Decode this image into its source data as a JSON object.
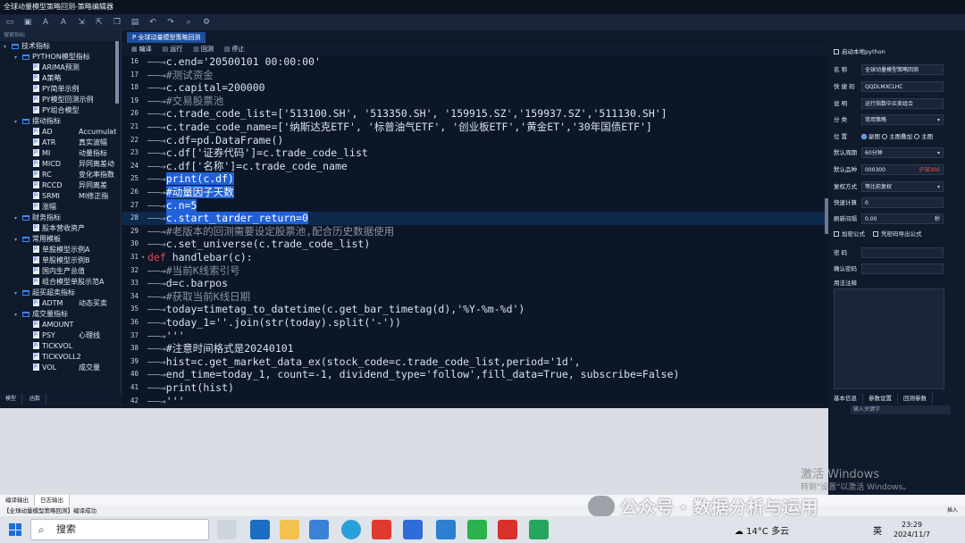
{
  "window": {
    "title": "全球动量模型策略回测-策略编辑器"
  },
  "left_panel": {
    "search_placeholder": "搜索指标",
    "tree": [
      {
        "level": 0,
        "type": "folder",
        "label": "技术指标",
        "expanded": true
      },
      {
        "level": 1,
        "type": "folder",
        "label": "PYTHON模型指标",
        "expanded": true
      },
      {
        "level": 2,
        "type": "file",
        "label": "ARIMA预测",
        "desc": ""
      },
      {
        "level": 2,
        "type": "file",
        "label": "A策略",
        "desc": ""
      },
      {
        "level": 2,
        "type": "file",
        "label": "PY简单示例",
        "desc": ""
      },
      {
        "level": 2,
        "type": "file",
        "label": "PY模型回测示例",
        "desc": ""
      },
      {
        "level": 2,
        "type": "file",
        "label": "PY组合模型",
        "desc": ""
      },
      {
        "level": 1,
        "type": "folder",
        "label": "摆动指标",
        "expanded": true
      },
      {
        "level": 2,
        "type": "file",
        "label": "AD",
        "desc": "Accumulat"
      },
      {
        "level": 2,
        "type": "file",
        "label": "ATR",
        "desc": "真实波幅"
      },
      {
        "level": 2,
        "type": "file",
        "label": "MI",
        "desc": "动量指标"
      },
      {
        "level": 2,
        "type": "file",
        "label": "MICD",
        "desc": "异同离差动"
      },
      {
        "level": 2,
        "type": "file",
        "label": "RC",
        "desc": "变化率指数"
      },
      {
        "level": 2,
        "type": "file",
        "label": "RCCD",
        "desc": "异同离差"
      },
      {
        "level": 2,
        "type": "file",
        "label": "SRMI",
        "desc": "MI修正指"
      },
      {
        "level": 2,
        "type": "file",
        "label": "涨幅",
        "desc": ""
      },
      {
        "level": 1,
        "type": "folder",
        "label": "财务指标",
        "expanded": true
      },
      {
        "level": 2,
        "type": "file",
        "label": "股本营收资产",
        "desc": ""
      },
      {
        "level": 1,
        "type": "folder",
        "label": "常用模板",
        "expanded": true
      },
      {
        "level": 2,
        "type": "file",
        "label": "单股模型示例A",
        "desc": ""
      },
      {
        "level": 2,
        "type": "file",
        "label": "单股模型示例B",
        "desc": ""
      },
      {
        "level": 2,
        "type": "file",
        "label": "国内生产总值",
        "desc": ""
      },
      {
        "level": 2,
        "type": "file",
        "label": "组合模型单股示范A",
        "desc": ""
      },
      {
        "level": 1,
        "type": "folder",
        "label": "超买超卖指标",
        "expanded": true
      },
      {
        "level": 2,
        "type": "file",
        "label": "ADTM",
        "desc": "动态买卖"
      },
      {
        "level": 1,
        "type": "folder",
        "label": "成交量指标",
        "expanded": true
      },
      {
        "level": 2,
        "type": "file",
        "label": "AMOUNT",
        "desc": ""
      },
      {
        "level": 2,
        "type": "file",
        "label": "PSY",
        "desc": "心理线"
      },
      {
        "level": 2,
        "type": "file",
        "label": "TICKVOL",
        "desc": ""
      },
      {
        "level": 2,
        "type": "file",
        "label": "TICKVOLL2",
        "desc": ""
      },
      {
        "level": 2,
        "type": "file",
        "label": "VOL",
        "desc": "成交量"
      }
    ],
    "tabs": [
      "模型",
      "函数"
    ]
  },
  "editor": {
    "tab_label": "全球动量模型策略回测",
    "tools": [
      "编译",
      "运行",
      "回测",
      "停止"
    ],
    "lines": [
      {
        "n": "16",
        "text": "c.end='20500101 00:00:00'",
        "kind": "plain",
        "indent": 1
      },
      {
        "n": "17",
        "text": "#测试资金",
        "kind": "cmt",
        "indent": 1
      },
      {
        "n": "18",
        "text": "c.capital=200000",
        "kind": "plain",
        "indent": 1
      },
      {
        "n": "19",
        "text": "#交易股票池",
        "kind": "cmt",
        "indent": 1
      },
      {
        "n": "20",
        "text": "c.trade_code_list=['513100.SH', '513350.SH', '159915.SZ','159937.SZ','511130.SH']",
        "kind": "plain",
        "indent": 1
      },
      {
        "n": "21",
        "text": "c.trade_code_name=['纳斯达克ETF', '标普油气ETF', '创业板ETF','黄金ET','30年国债ETF']",
        "kind": "plain",
        "indent": 1
      },
      {
        "n": "22",
        "text": "c.df=pd.DataFrame()",
        "kind": "plain",
        "indent": 1
      },
      {
        "n": "23",
        "text": "c.df['证券代码']=c.trade_code_list",
        "kind": "plain",
        "indent": 1
      },
      {
        "n": "24",
        "text": "c.df['名称']=c.trade_code_name",
        "kind": "plain",
        "indent": 1
      },
      {
        "n": "25",
        "text": "print(c.df)",
        "kind": "sel",
        "indent": 1
      },
      {
        "n": "26",
        "text": "#动量因子天数",
        "kind": "sel",
        "indent": 1
      },
      {
        "n": "27",
        "text": "c.n=5",
        "kind": "sel",
        "indent": 1
      },
      {
        "n": "28",
        "text": "c.start_tarder_return=0",
        "kind": "sel",
        "indent": 1,
        "hl": true
      },
      {
        "n": "29",
        "text": "#老版本的回测需要设定股票池,配合历史数据使用",
        "kind": "cmt",
        "indent": 1
      },
      {
        "n": "30",
        "text": "c.set_universe(c.trade_code_list)",
        "kind": "plain",
        "indent": 1
      },
      {
        "n": "31",
        "text": "def handlebar(c):",
        "kind": "def",
        "indent": 0,
        "fold": true
      },
      {
        "n": "32",
        "text": "#当前K线索引号",
        "kind": "cmt",
        "indent": 1
      },
      {
        "n": "33",
        "text": "d=c.barpos",
        "kind": "plain",
        "indent": 1
      },
      {
        "n": "34",
        "text": "#获取当前K线日期",
        "kind": "cmt",
        "indent": 1
      },
      {
        "n": "35",
        "text": "today=timetag_to_datetime(c.get_bar_timetag(d),'%Y-%m-%d')",
        "kind": "plain",
        "indent": 1
      },
      {
        "n": "36",
        "text": "today_1=''.join(str(today).split('-'))",
        "kind": "plain",
        "indent": 1
      },
      {
        "n": "37",
        "text": "'''",
        "kind": "plain",
        "indent": 1
      },
      {
        "n": "38",
        "text": "#注意时间格式是20240101",
        "kind": "cmt2",
        "indent": 1
      },
      {
        "n": "39",
        "text": "hist=c.get_market_data_ex(stock_code=c.trade_code_list,period='1d',",
        "kind": "plain",
        "indent": 1
      },
      {
        "n": "40",
        "text": "end_time=today_1, count=-1, dividend_type='follow',fill_data=True, subscribe=False)",
        "kind": "plain",
        "indent": 1
      },
      {
        "n": "41",
        "text": "print(hist)",
        "kind": "plain",
        "indent": 1
      },
      {
        "n": "42",
        "text": "'''",
        "kind": "plain",
        "indent": 1
      }
    ]
  },
  "right_panel": {
    "local_python_label": "启动本地python",
    "fields": [
      {
        "label": "名  称",
        "value": "全球动量模型策略回测"
      },
      {
        "label": "快 捷 码",
        "value": "QQDLMXCLHC"
      },
      {
        "label": "说  明",
        "value": "运行指数中买卖组合"
      },
      {
        "label": "分  类",
        "value": "常用策略",
        "drop": true
      }
    ],
    "position_label": "位  置",
    "position_options": [
      "副图",
      "主图叠加",
      "主图"
    ],
    "position_selected": "副图",
    "period_label": "默认周期",
    "period_value": "60分钟",
    "product_label": "默认品种",
    "product_code": "000300",
    "product_market": "沪深300",
    "rights_label": "复权方式",
    "rights_value": "等比前复权",
    "fast_calc_label": "快速计算",
    "fast_calc_value": "0",
    "refresh_label": "刷新间隔",
    "refresh_value": "0.00",
    "refresh_unit": "秒",
    "encrypt_label": "加密公式",
    "export_label": "凭密码导出公式",
    "password_label": "密  码",
    "confirm_label": "确认密码",
    "notes_label": "用法注释",
    "tabs": [
      "基本信息",
      "参数设置",
      "回测参数"
    ]
  },
  "output": {
    "search_placeholder": "输入关键字",
    "tabs": [
      "编译输出",
      "日志输出"
    ],
    "status": "【全球动量模型策略回测】编译成功",
    "status_right": "插入"
  },
  "watermarks": {
    "win_activate": "激活 Windows",
    "win_hint": "转到\"设置\"以激活 Windows。",
    "wechat": "公众号 · 数据分析与运用"
  },
  "taskbar": {
    "search": "搜索",
    "weather": "14°C 多云",
    "lang": "英",
    "time": "23:29",
    "date": "2024/11/7"
  }
}
